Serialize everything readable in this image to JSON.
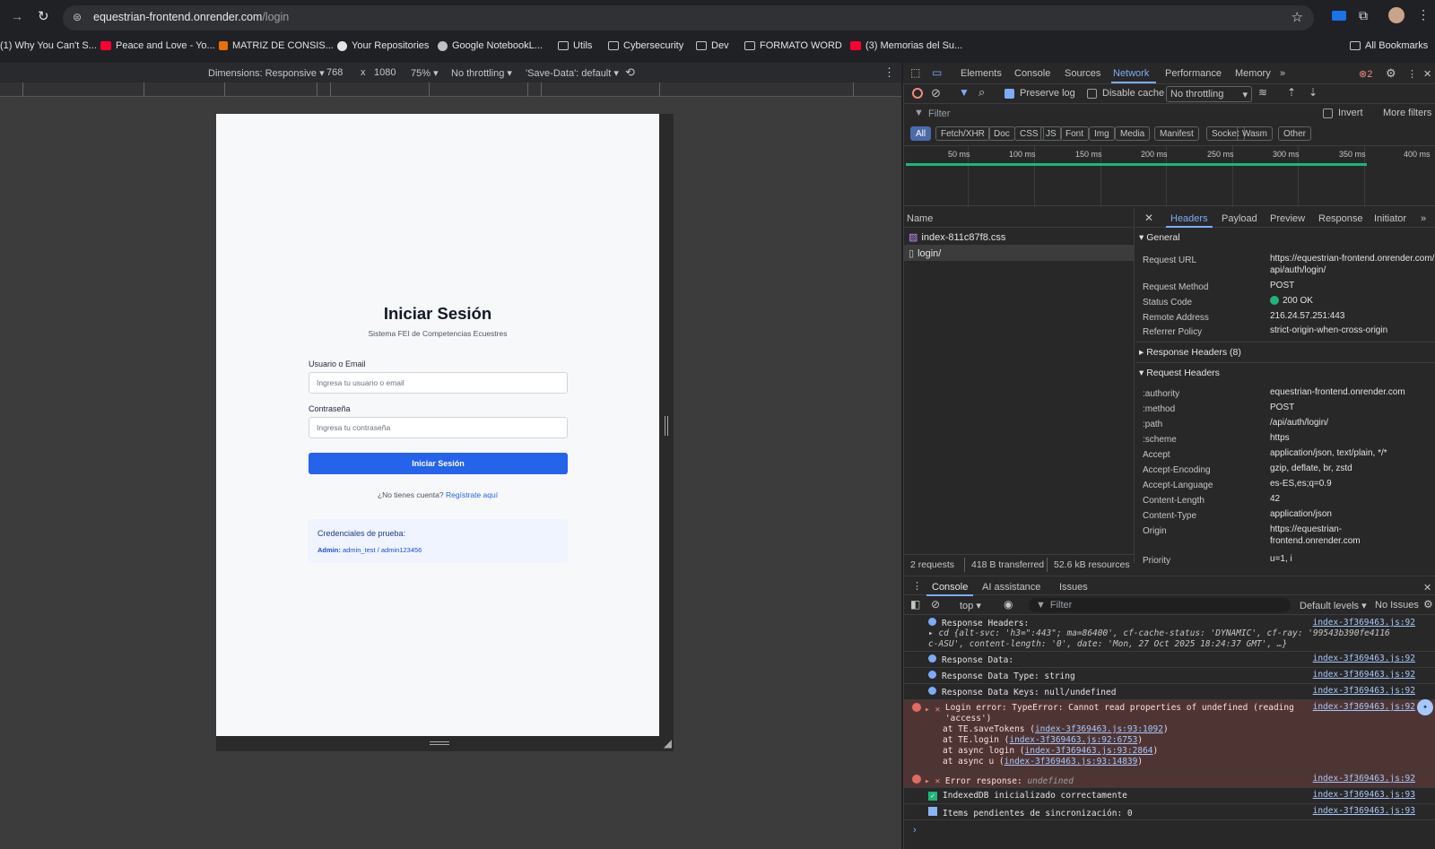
{
  "browser": {
    "url_host": "equestrian-frontend.onrender.com",
    "url_path": "/login",
    "bookmarks": [
      {
        "label": "(1) Why You Can't S...",
        "icon": "youtube-icon"
      },
      {
        "label": "Peace and Love - Yo...",
        "icon": "youtube-icon"
      },
      {
        "label": "MATRIZ DE CONSIS...",
        "icon": "doc-icon"
      },
      {
        "label": "Your Repositories",
        "icon": "github-icon"
      },
      {
        "label": "Google NotebookL...",
        "icon": "notebook-icon"
      },
      {
        "label": "Utils",
        "icon": "folder-icon"
      },
      {
        "label": "Cybersecurity",
        "icon": "folder-icon"
      },
      {
        "label": "Dev",
        "icon": "folder-icon"
      },
      {
        "label": "FORMATO WORD",
        "icon": "folder-icon"
      },
      {
        "label": "(3) Memorias del Su...",
        "icon": "youtube-icon"
      }
    ],
    "all_bookmarks": "All Bookmarks"
  },
  "device_toolbar": {
    "dimensions": "Dimensions: Responsive",
    "width": "768",
    "times": "x",
    "height": "1080",
    "zoom": "75%",
    "throttling": "No throttling",
    "save_data": "'Save-Data': default"
  },
  "login": {
    "title": "Iniciar Sesión",
    "subtitle": "Sistema FEI de Competencias Ecuestres",
    "user_label": "Usuario o Email",
    "user_placeholder": "Ingresa tu usuario o email",
    "password_label": "Contraseña",
    "password_placeholder": "Ingresa tu contraseña",
    "submit": "Iniciar Sesión",
    "no_account": "¿No tienes cuenta?",
    "register_link": "Regístrate aquí",
    "creds_title": "Credenciales de prueba:",
    "creds_role": "Admin:",
    "creds_value": "admin_test / admin123456"
  },
  "devtools": {
    "tabs": [
      "Elements",
      "Console",
      "Sources",
      "Network",
      "Performance",
      "Memory"
    ],
    "active_tab": "Network",
    "error_count": "2",
    "preserve_log": "Preserve log",
    "disable_cache": "Disable cache",
    "throttling": "No throttling",
    "filter_placeholder": "Filter",
    "invert": "Invert",
    "more_filters": "More filters",
    "type_filters": [
      "All",
      "Fetch/XHR",
      "Doc",
      "CSS",
      "JS",
      "Font",
      "Img",
      "Media",
      "Manifest",
      "Socket",
      "Wasm",
      "Other"
    ],
    "timeline_ticks": [
      "50 ms",
      "100 ms",
      "150 ms",
      "200 ms",
      "250 ms",
      "300 ms",
      "350 ms",
      "400 ms"
    ],
    "name_header": "Name",
    "requests": [
      "index-811c87f8.css",
      "login/"
    ],
    "summary": {
      "requests": "2 requests",
      "transferred": "418 B transferred",
      "resources": "52.6 kB resources"
    },
    "detail_tabs": [
      "Headers",
      "Payload",
      "Preview",
      "Response",
      "Initiator"
    ],
    "general_title": "General",
    "general": [
      {
        "k": "Request URL",
        "v": "https://equestrian-frontend.onrender.com/api/auth/login/"
      },
      {
        "k": "Request Method",
        "v": "POST"
      },
      {
        "k": "Status Code",
        "v": "200 OK"
      },
      {
        "k": "Remote Address",
        "v": "216.24.57.251:443"
      },
      {
        "k": "Referrer Policy",
        "v": "strict-origin-when-cross-origin"
      }
    ],
    "response_headers_title": "Response Headers (8)",
    "request_headers_title": "Request Headers",
    "request_headers": [
      {
        "k": ":authority",
        "v": "equestrian-frontend.onrender.com"
      },
      {
        "k": ":method",
        "v": "POST"
      },
      {
        "k": ":path",
        "v": "/api/auth/login/"
      },
      {
        "k": ":scheme",
        "v": "https"
      },
      {
        "k": "Accept",
        "v": "application/json, text/plain, */*"
      },
      {
        "k": "Accept-Encoding",
        "v": "gzip, deflate, br, zstd"
      },
      {
        "k": "Accept-Language",
        "v": "es-ES,es;q=0.9"
      },
      {
        "k": "Content-Length",
        "v": "42"
      },
      {
        "k": "Content-Type",
        "v": "application/json"
      },
      {
        "k": "Origin",
        "v": "https://equestrian-frontend.onrender.com"
      },
      {
        "k": "Priority",
        "v": "u=1, i"
      }
    ],
    "console_tabs": [
      "Console",
      "AI assistance",
      "Issues"
    ],
    "console_context": "top",
    "console_filter": "Filter",
    "default_levels": "Default levels",
    "no_issues": "No Issues",
    "source_92": "index-3f369463.js:92",
    "source_93": "index-3f369463.js:93",
    "logs": {
      "resp_headers_label": "Response Headers:",
      "resp_headers_obj": "cd {alt-svc: 'h3=\":443\"; ma=86400', cf-cache-status: 'DYNAMIC', cf-ray: '99543b390fe4116c-ASU', content-length: '0', date: 'Mon, 27 Oct 2025 18:24:37 GMT', …}",
      "resp_data": "Response Data:",
      "resp_type": "Response Data Type: string",
      "resp_keys": "Response Data Keys: null/undefined",
      "login_error": "Login error: TypeError: Cannot read properties of undefined (reading 'access')",
      "stack1_fn": "at TE.saveTokens (",
      "stack1_src": "index-3f369463.js:93:1092",
      "stack2_fn": "at TE.login (",
      "stack2_src": "index-3f369463.js:92:6753",
      "stack3_fn": "at async login (",
      "stack3_src": "index-3f369463.js:93:2864",
      "stack4_fn": "at async u (",
      "stack4_src": "index-3f369463.js:93:14839",
      "error_response": "Error response:",
      "error_response_val": "undefined",
      "indexeddb": "IndexedDB inicializado correctamente",
      "pending": "Items pendientes de sincronización: 0"
    }
  }
}
